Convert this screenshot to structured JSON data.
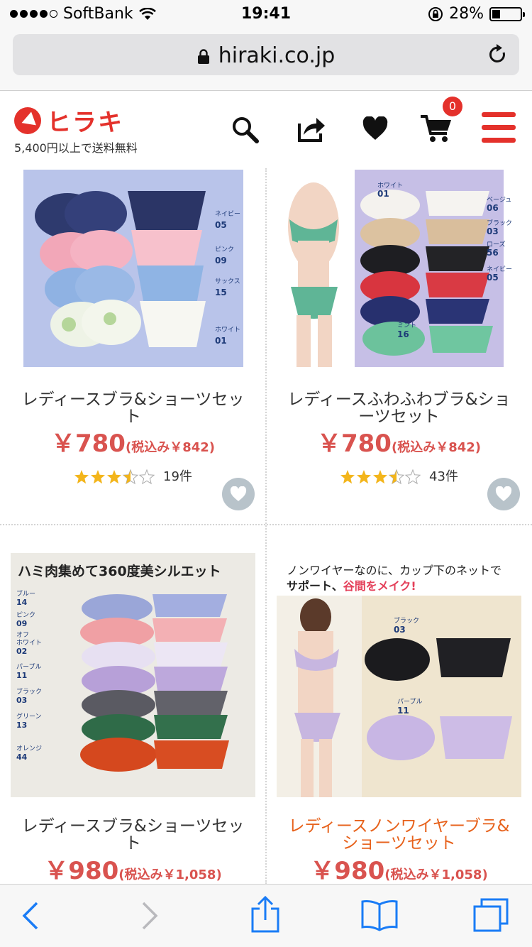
{
  "status_bar": {
    "carrier": "SoftBank",
    "time": "19:41",
    "battery": "28%",
    "battery_level": 0.28
  },
  "browser": {
    "url": "hiraki.co.jp"
  },
  "site_header": {
    "logo_text": "ヒラキ",
    "shipping_note": "5,400円以上で送料無料",
    "cart_count": "0",
    "brand_color": "#e4312b"
  },
  "products": [
    {
      "title_line1": "レディースブラ&ショーツセッ",
      "title_line2": "ト",
      "price": "￥780",
      "tax_price": "(税込み￥842)",
      "rating": 3.5,
      "review_count": "19件",
      "title_color": "#333333"
    },
    {
      "title_line1": "レディースふわふわブラ&ショ",
      "title_line2": "ーツセット",
      "price": "￥780",
      "tax_price": "(税込み￥842)",
      "rating": 3.5,
      "review_count": "43件",
      "title_color": "#333333"
    },
    {
      "title_line1": "レディースブラ&ショーツセッ",
      "title_line2": "ト",
      "price": "￥980",
      "tax_price": "(税込み￥1,058)",
      "image_caption": "ハミ肉集めて360度美シルエット",
      "color_labels": [
        "ブルー 14",
        "ピンク 09",
        "オフホワイト 02",
        "パープル 11",
        "ブラック 03",
        "グリーン 13",
        "オレンジ 44"
      ],
      "title_color": "#333333"
    },
    {
      "title_line1": "レディースノンワイヤーブラ&",
      "title_line2": "ショーツセット",
      "price": "￥980",
      "tax_price": "(税込み￥1,058)",
      "image_caption_line1": "ノンワイヤーなのに、カップ下のネットで",
      "image_caption_line2a": "サポート、",
      "image_caption_line2b": "谷間をメイク!",
      "color_labels": [
        "ブラック 03",
        "パープル 11"
      ],
      "title_color": "#e7621c"
    }
  ],
  "image_labels": {
    "p1": [
      "ネイビー",
      "05",
      "ピンク",
      "09",
      "サックス",
      "15",
      "ホワイト",
      "01"
    ],
    "p2": [
      "ホワイト",
      "01",
      "ベージュ",
      "06",
      "ブラック",
      "03",
      "ローズ",
      "56",
      "ネイビー",
      "05",
      "ミント",
      "16"
    ],
    "p3": [
      "ブルー",
      "14",
      "ピンク",
      "09",
      "オフ",
      "ホワイト",
      "02",
      "パープル",
      "11",
      "ブラック",
      "03",
      "グリーン",
      "13",
      "オレンジ",
      "44"
    ],
    "p4": [
      "ブラック",
      "03",
      "パープル",
      "11"
    ]
  },
  "toolbar": {
    "back": "back-icon",
    "forward": "forward-icon",
    "share": "share-icon",
    "bookmarks": "bookmarks-icon",
    "tabs": "tabs-icon",
    "accent": "#1a7cf6"
  }
}
